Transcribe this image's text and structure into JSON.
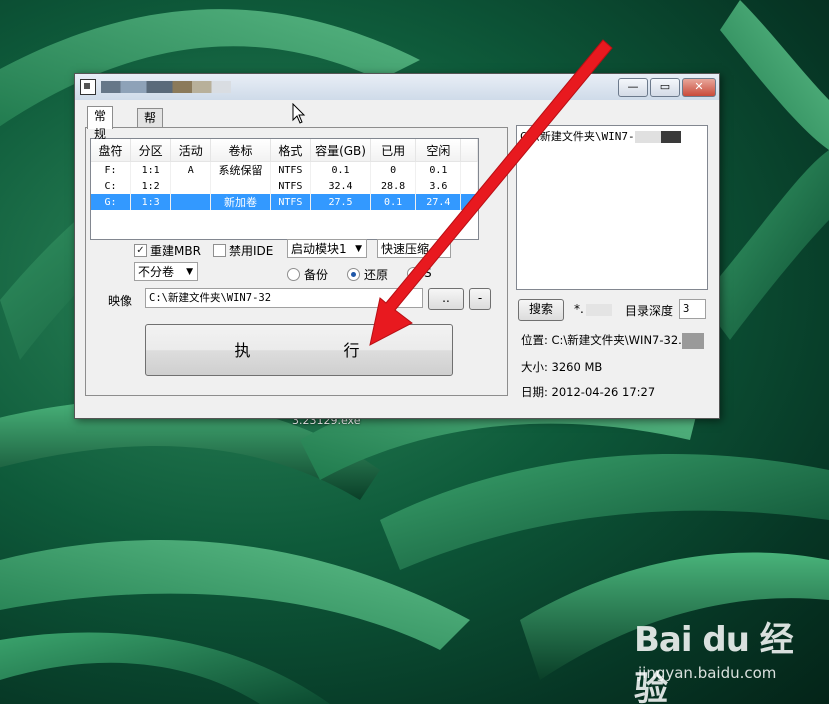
{
  "desktop": {
    "filename_fragment": "3.23129.exe",
    "watermark": {
      "logo": "Bai du 经验",
      "url": "jingyan.baidu.com"
    }
  },
  "window": {
    "title": "",
    "caption_buttons": {
      "minimize": "—",
      "maximize": "▭",
      "close": "✕"
    },
    "tabs": [
      {
        "label": "常规",
        "active": true
      },
      {
        "label": "帮助",
        "active": false
      }
    ],
    "partition_table": {
      "columns": [
        "盘符",
        "分区",
        "活动",
        "卷标",
        "格式",
        "容量(GB)",
        "已用",
        "空闲"
      ],
      "rows": [
        {
          "cells": [
            "F:",
            "1:1",
            "A",
            "系统保留",
            "NTFS",
            "0.1",
            "0",
            "0.1"
          ],
          "selected": false
        },
        {
          "cells": [
            "C:",
            "1:2",
            "",
            "",
            "NTFS",
            "32.4",
            "28.8",
            "3.6"
          ],
          "selected": false
        },
        {
          "cells": [
            "G:",
            "1:3",
            "",
            "新加卷",
            "NTFS",
            "27.5",
            "0.1",
            "27.4"
          ],
          "selected": true
        }
      ]
    },
    "options": {
      "rebuild_mbr": {
        "label": "重建MBR",
        "checked": true
      },
      "disable_ide": {
        "label": "禁用IDE",
        "checked": false
      },
      "boot_module": "启动模块1",
      "compression": "快速压缩",
      "split": "不分卷",
      "modes": [
        {
          "label": "备份",
          "selected": false
        },
        {
          "label": "还原",
          "selected": true
        },
        {
          "label": "S",
          "selected": false
        }
      ]
    },
    "image": {
      "label": "映像",
      "path": "C:\\新建文件夹\\WIN7-32",
      "browse_button": "..",
      "minus_button": "-"
    },
    "execute_button": "执 行",
    "right_panel": {
      "list_item": "C:\\新建文件夹\\WIN7-",
      "search_button": "搜索",
      "pattern": "*.",
      "depth_label": "目录深度",
      "depth_value": "3",
      "location": "位置: C:\\新建文件夹\\WIN7-32.",
      "size": "大小: 3260 MB",
      "date": "日期: 2012-04-26  17:27"
    }
  },
  "colors": {
    "selection": "#3399ff",
    "arrow": "#e8191f"
  }
}
